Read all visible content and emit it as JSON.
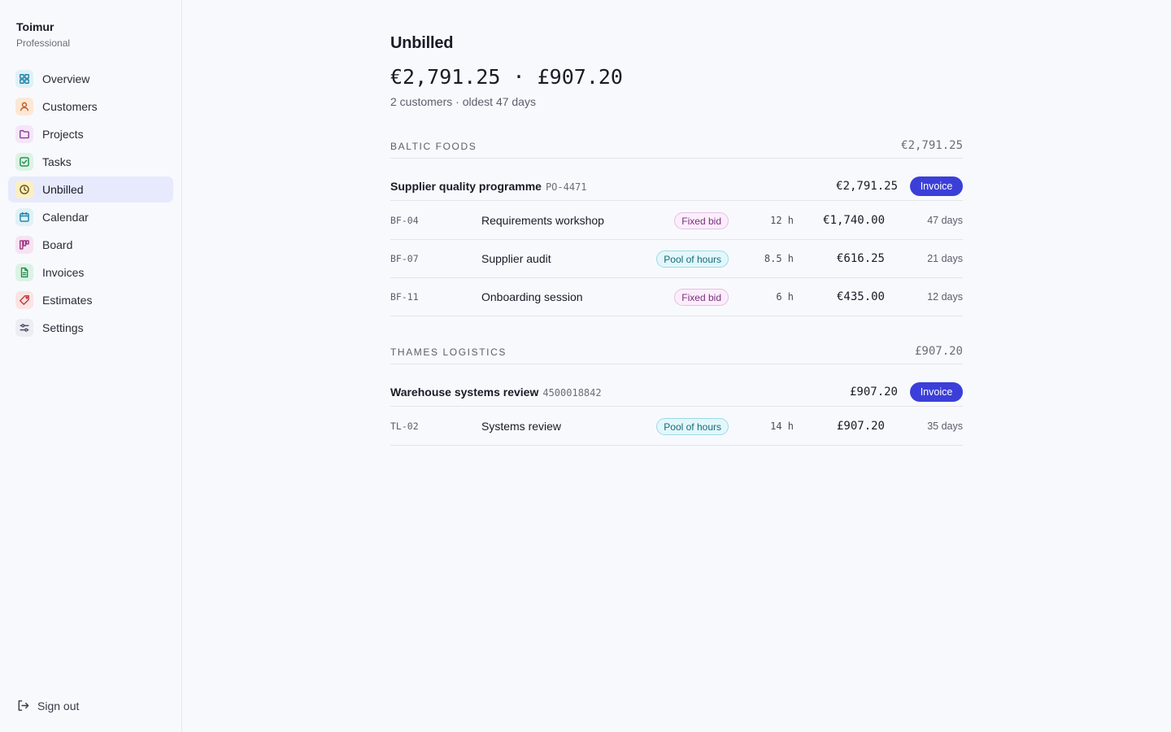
{
  "sidebar": {
    "org_name": "Toimur",
    "plan": "Professional",
    "items": [
      {
        "label": "Overview",
        "icon": "grid-icon",
        "color": "#1e7fa6",
        "bg": "#dff1f7"
      },
      {
        "label": "Customers",
        "icon": "user-icon",
        "color": "#c2571a",
        "bg": "#fde7d6"
      },
      {
        "label": "Projects",
        "icon": "folder-icon",
        "color": "#8a3b9c",
        "bg": "#f4e6f7"
      },
      {
        "label": "Tasks",
        "icon": "checkbox-icon",
        "color": "#1f8a4c",
        "bg": "#dcf3e4"
      },
      {
        "label": "Unbilled",
        "icon": "clock-icon",
        "color": "#8a6b10",
        "bg": "#fbefc4"
      },
      {
        "label": "Calendar",
        "icon": "calendar-icon",
        "color": "#1e7fa6",
        "bg": "#dff1f7"
      },
      {
        "label": "Board",
        "icon": "kanban-icon",
        "color": "#9c2f7f",
        "bg": "#f6e3f1"
      },
      {
        "label": "Invoices",
        "icon": "document-icon",
        "color": "#1f8a4c",
        "bg": "#dcf3e4"
      },
      {
        "label": "Estimates",
        "icon": "tag-icon",
        "color": "#c23a3a",
        "bg": "#fbe4e4"
      },
      {
        "label": "Settings",
        "icon": "sliders-icon",
        "color": "#4a4f63",
        "bg": "#eceef3"
      }
    ],
    "active_index": 4,
    "signout_label": "Sign out"
  },
  "page": {
    "title": "Unbilled",
    "totals": "€2,791.25 · £907.20",
    "summary": "2 customers · oldest 47 days"
  },
  "groups": [
    {
      "name": "BALTIC FOODS",
      "total": "€2,791.25",
      "project": {
        "name": "Supplier quality programme",
        "ref": "PO-4471",
        "amount": "€2,791.25",
        "action": "Invoice"
      },
      "tasks": [
        {
          "code": "BF-04",
          "name": "Requirements workshop",
          "billing": "Fixed bid",
          "hours": "12 h",
          "amount": "€1,740.00",
          "age": "47 days"
        },
        {
          "code": "BF-07",
          "name": "Supplier audit",
          "billing": "Pool of hours",
          "hours": "8.5 h",
          "amount": "€616.25",
          "age": "21 days"
        },
        {
          "code": "BF-11",
          "name": "Onboarding session",
          "billing": "Fixed bid",
          "hours": "6 h",
          "amount": "€435.00",
          "age": "12 days"
        }
      ]
    },
    {
      "name": "THAMES LOGISTICS",
      "total": "£907.20",
      "project": {
        "name": "Warehouse systems review",
        "ref": "4500018842",
        "amount": "£907.20",
        "action": "Invoice"
      },
      "tasks": [
        {
          "code": "TL-02",
          "name": "Systems review",
          "billing": "Pool of hours",
          "hours": "14 h",
          "amount": "£907.20",
          "age": "35 days"
        }
      ]
    }
  ],
  "colors": {
    "accent": "#3b3fd8",
    "active_nav_bg": "#e7eafc",
    "fixed_badge": "#7b2e7c",
    "pool_badge": "#136a7a"
  }
}
